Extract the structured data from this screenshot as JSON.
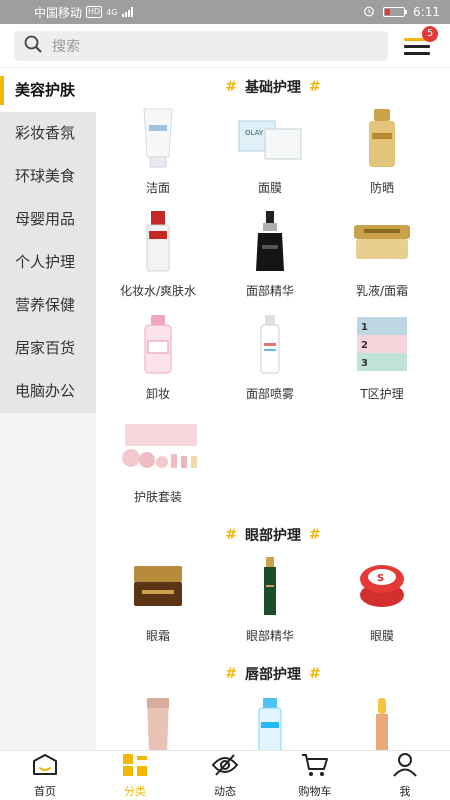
{
  "status_bar": {
    "carrier": "中国移动",
    "hd": "HD",
    "network": "4G",
    "time": "6:11",
    "battery_level": 0.3
  },
  "header": {
    "search_placeholder": "搜索",
    "menu_badge": "5"
  },
  "sidebar": {
    "items": [
      {
        "label": "美容护肤",
        "active": true
      },
      {
        "label": "彩妆香氛"
      },
      {
        "label": "环球美食"
      },
      {
        "label": "母婴用品"
      },
      {
        "label": "个人护理"
      },
      {
        "label": "营养保健"
      },
      {
        "label": "居家百货"
      },
      {
        "label": "电脑办公"
      }
    ]
  },
  "sections": [
    {
      "title": "基础护理",
      "items": [
        {
          "label": "洁面",
          "icon": "cleanser-tube"
        },
        {
          "label": "面膜",
          "icon": "face-mask-box"
        },
        {
          "label": "防晒",
          "icon": "sunscreen-bottle"
        },
        {
          "label": "化妆水/爽肤水",
          "icon": "toner-bottle"
        },
        {
          "label": "面部精华",
          "icon": "serum-bottle"
        },
        {
          "label": "乳液/面霜",
          "icon": "cream-jar"
        },
        {
          "label": "卸妆",
          "icon": "makeup-remover-bottle"
        },
        {
          "label": "面部喷雾",
          "icon": "face-spray"
        },
        {
          "label": "T区护理",
          "icon": "nose-strips"
        },
        {
          "label": "护肤套装",
          "icon": "skincare-set"
        }
      ]
    },
    {
      "title": "眼部护理",
      "items": [
        {
          "label": "眼霜",
          "icon": "eye-cream-jar"
        },
        {
          "label": "眼部精华",
          "icon": "eye-serum-tube"
        },
        {
          "label": "眼膜",
          "icon": "eye-mask-jar"
        }
      ]
    },
    {
      "title": "唇部护理",
      "items": [
        {
          "label": "",
          "icon": "lip-tube"
        },
        {
          "label": "",
          "icon": "lip-bottle"
        },
        {
          "label": "",
          "icon": "lip-balm"
        }
      ]
    }
  ],
  "bottom_nav": [
    {
      "label": "首页",
      "icon": "home-icon"
    },
    {
      "label": "分类",
      "icon": "category-icon",
      "active": true
    },
    {
      "label": "动态",
      "icon": "eye-slash-icon"
    },
    {
      "label": "购物车",
      "icon": "cart-icon"
    },
    {
      "label": "我",
      "icon": "user-icon"
    }
  ],
  "colors": {
    "accent": "#f2b705",
    "badge": "#e53935",
    "status_bar": "#9e9e9e"
  }
}
